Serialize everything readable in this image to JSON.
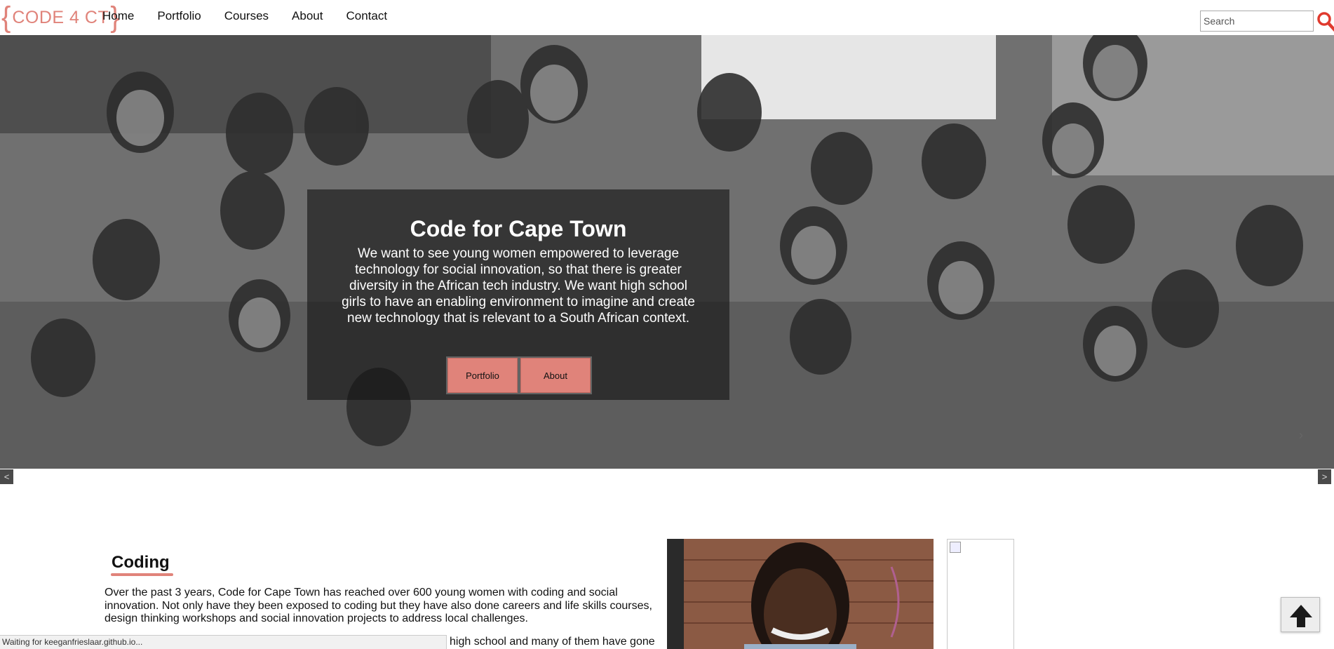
{
  "nav": {
    "logo_text": "CODE 4 CT",
    "items": [
      {
        "label": "Home"
      },
      {
        "label": "Portfolio"
      },
      {
        "label": "Courses"
      },
      {
        "label": "About"
      },
      {
        "label": "Contact"
      }
    ],
    "search_placeholder": "Search",
    "search_icon": "magnifier-icon"
  },
  "hero": {
    "title": "Code for Cape Town",
    "body": "We want to see young women empowered to leverage technology for social innovation, so that there is greater diversity in the African tech industry. We want high school girls to have an enabling environment to imagine and create new technology that is relevant to a South African context.",
    "buttons": [
      {
        "label": "Portfolio"
      },
      {
        "label": "About"
      }
    ],
    "prev_arrow": "<",
    "next_arrow": ">",
    "caret": "›"
  },
  "coding": {
    "title": "Coding",
    "paragraph1": "Over the past 3 years, Code for Cape Town has reached over 600 young women with coding and social innovation. Not only have they been exposed to coding but they have also done careers and life skills courses, design thinking workshops and social innovation projects to address local challenges.",
    "paragraph2_fragment": "high school and many of them have gone"
  },
  "status_bar": {
    "text": "Waiting for keeganfrieslaar.github.io..."
  },
  "colors": {
    "accent": "#e0837a",
    "overlay": "#141414"
  },
  "icons": {
    "back_to_top": "arrow-up-icon"
  }
}
